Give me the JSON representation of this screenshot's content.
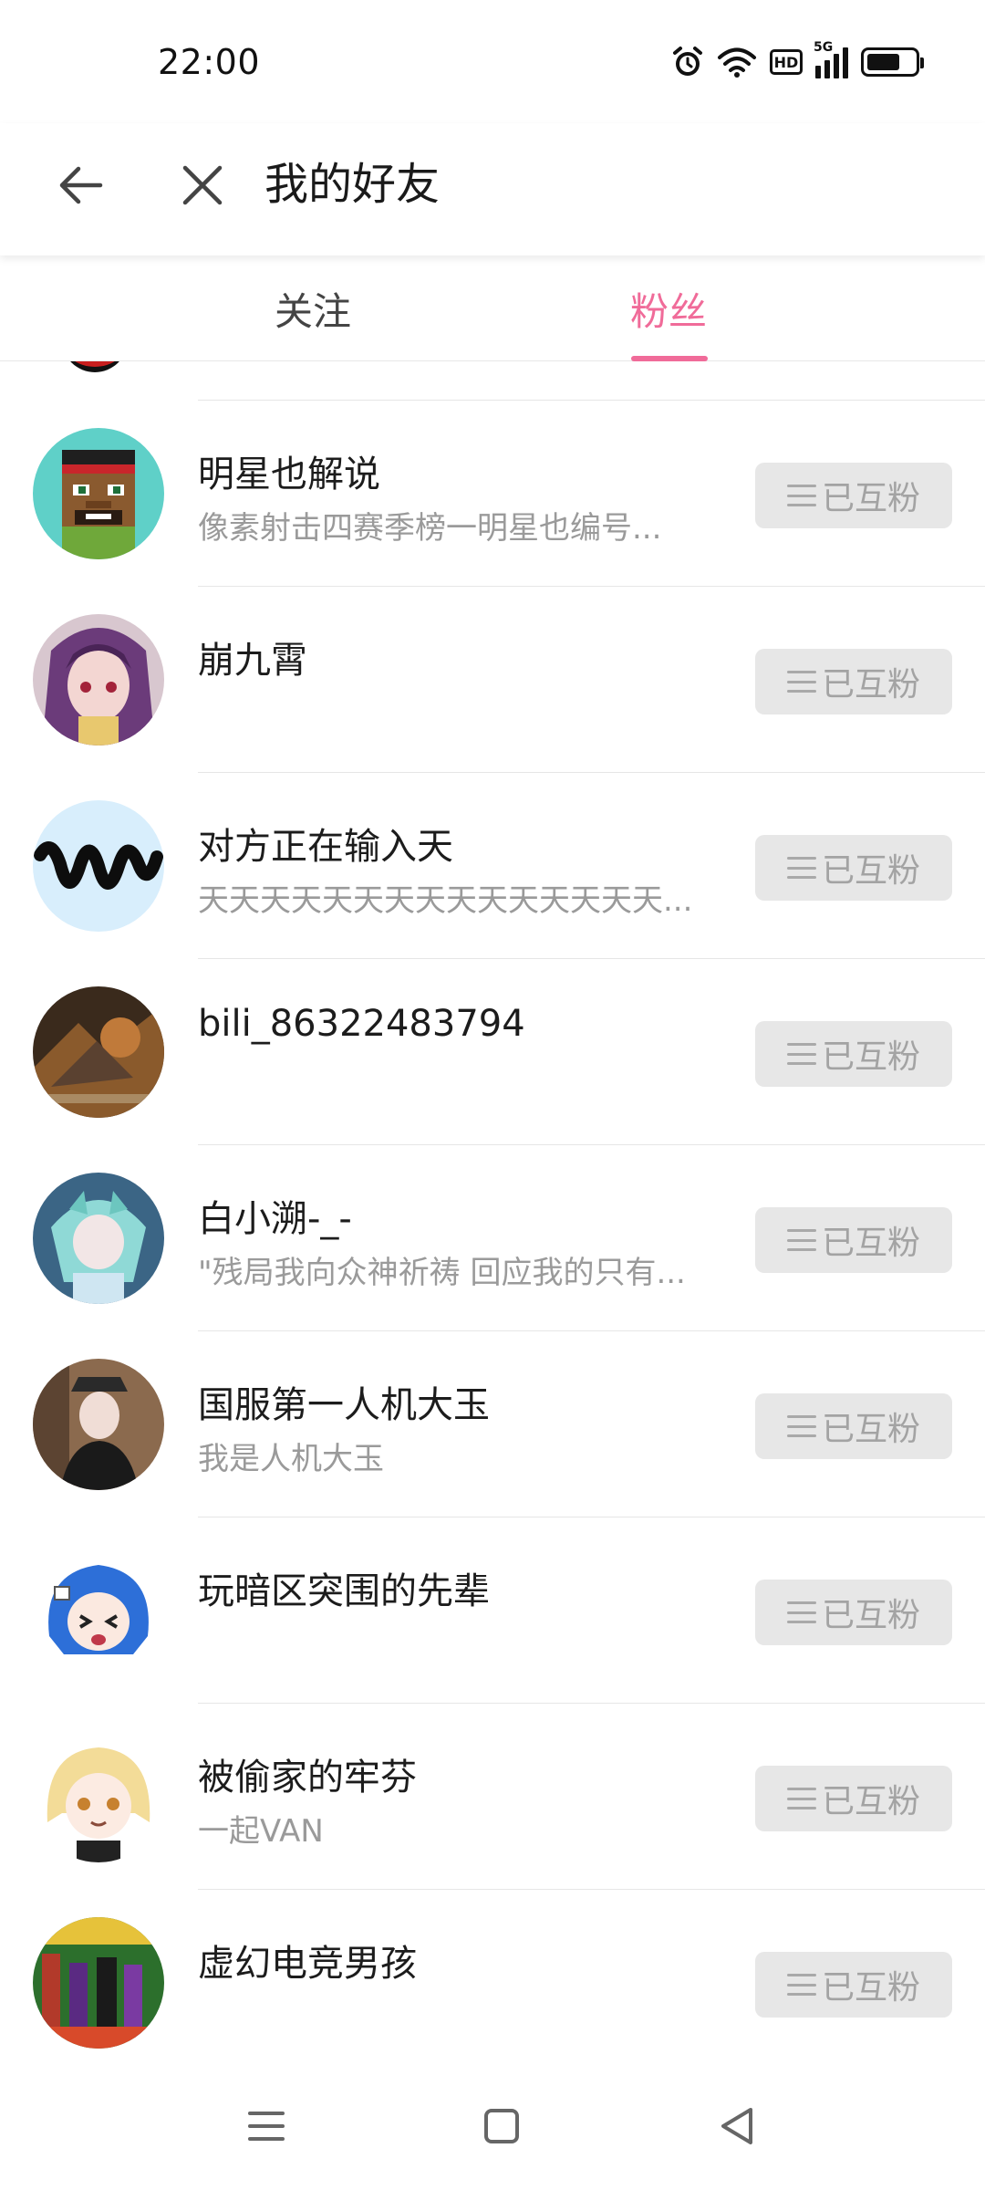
{
  "status_bar": {
    "time": "22:00",
    "icons": [
      "alarm-icon",
      "wifi-icon",
      "hd-icon",
      "5g-signal-icon",
      "battery-icon"
    ],
    "hd_label": "HD",
    "network_label": "5G",
    "battery_level": 0.7
  },
  "header": {
    "title": "我的好友",
    "back_icon": "arrow-left-icon",
    "close_icon": "close-icon"
  },
  "tabs": {
    "follow": "关注",
    "fans": "粉丝",
    "active": "粉丝",
    "accent_color": "#f06b99"
  },
  "button_label": "已互粉",
  "users": [
    {
      "name": "明星也解说",
      "signature": "像素射击四赛季榜一明星也编号...",
      "avatar": "pixel-character-avatar"
    },
    {
      "name": "崩九霄",
      "signature": "",
      "avatar": "anime-purple-hair-avatar"
    },
    {
      "name": "对方正在输入天",
      "signature": "天天天天天天天天天天天天天天天...",
      "avatar": "wave-logo-avatar"
    },
    {
      "name": "bili_86322483794",
      "signature": "",
      "avatar": "game-art-avatar"
    },
    {
      "name": "白小溯-_-",
      "signature": "\"残局我向众神祈祷 回应我的只有...",
      "avatar": "anime-blue-avatar"
    },
    {
      "name": "国服第一人机大玉",
      "signature": "我是人机大玉",
      "avatar": "person-photo-avatar"
    },
    {
      "name": "玩暗区突围的先辈",
      "signature": "",
      "avatar": "anime-blue-hair-avatar"
    },
    {
      "name": "被偷家的牢芬",
      "signature": "一起VAN",
      "avatar": "anime-blonde-avatar"
    },
    {
      "name": "虚幻电竞男孩",
      "signature": "",
      "avatar": "pixel-game-avatar"
    }
  ],
  "navbar": {
    "icons": [
      "menu-icon",
      "home-square-icon",
      "back-triangle-icon"
    ]
  }
}
